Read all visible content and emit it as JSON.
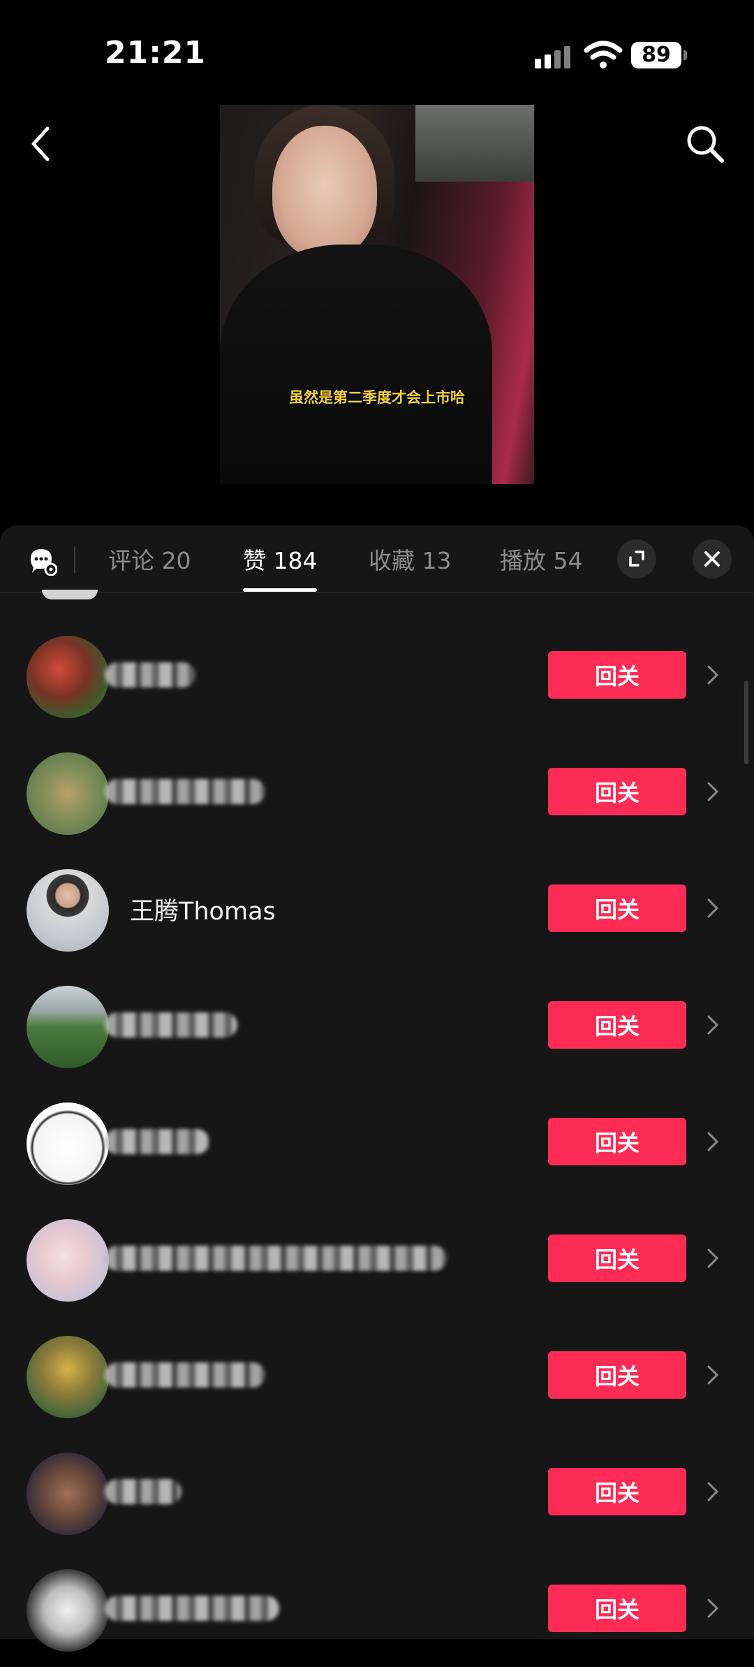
{
  "status_bar": {
    "time": "21:21",
    "battery": "89",
    "icons": [
      "signal-icon",
      "wifi-icon",
      "battery-icon"
    ]
  },
  "top_bar": {
    "icons": [
      "back-icon",
      "search-icon"
    ]
  },
  "video": {
    "subtitle": "虽然是第二季度才会上市哈"
  },
  "tabs": [
    {
      "label": "评论 20",
      "active": false
    },
    {
      "label": "赞 184",
      "active": true
    },
    {
      "label": "收藏 13",
      "active": false
    },
    {
      "label": "播放 54",
      "active": false
    }
  ],
  "tab_icons": [
    "chat-settings-icon",
    "expand-icon",
    "close-icon"
  ],
  "colors": {
    "accent": "#fe2c55",
    "sheet_bg": "#161616",
    "subtitle": "#f5d13b"
  },
  "likers": [
    {
      "name": "",
      "button": "回关"
    },
    {
      "name": "",
      "button": "回关"
    },
    {
      "name": "王腾Thomas",
      "button": "回关"
    },
    {
      "name": "",
      "button": "回关"
    },
    {
      "name": "",
      "button": "回关"
    },
    {
      "name": "",
      "button": "回关"
    },
    {
      "name": "",
      "button": "回关"
    },
    {
      "name": "",
      "button": "回关"
    },
    {
      "name": "",
      "button": "回关"
    }
  ]
}
